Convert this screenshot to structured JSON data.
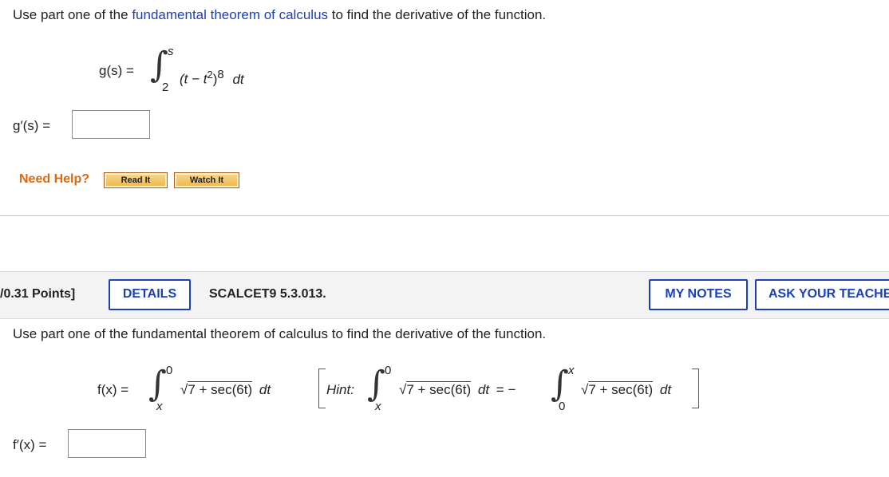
{
  "q1": {
    "prompt_pre": "Use part one of the ",
    "prompt_link": "fundamental theorem of calculus",
    "prompt_post": " to find the derivative of the function.",
    "func_lhs": "g(s) =",
    "upper_limit": "s",
    "lower_limit": "2",
    "integrand": "(t − t",
    "exp1": "2",
    "integrand_mid": ")",
    "exp2": "8",
    "dt": "dt",
    "answer_label": "g′(s) =",
    "answer_value": ""
  },
  "help": {
    "label": "Need Help?",
    "read_it": "Read It",
    "watch_it": "Watch It"
  },
  "q2": {
    "points": "/0.31 Points]",
    "details": "DETAILS",
    "code": "SCALCET9 5.3.013.",
    "my_notes": "MY NOTES",
    "ask_teacher": "ASK YOUR TEACHER",
    "prompt": "Use part one of the fundamental theorem of calculus to find the derivative of the function.",
    "func_lhs": "f(x) =",
    "upper_limit": "0",
    "lower_limit": "x",
    "integrand": "7 + sec(6t)",
    "dt": "dt",
    "hint_label": "Hint:",
    "hint_upper": "0",
    "hint_lower": "x",
    "hint_integrand": "7 + sec(6t)",
    "hint_dt": "dt",
    "equals_minus": "= −",
    "hint2_upper": "x",
    "hint2_lower": "0",
    "hint2_integrand": "7 + sec(6t)",
    "hint2_dt": "dt",
    "answer_label": "f′(x) =",
    "answer_value": ""
  }
}
